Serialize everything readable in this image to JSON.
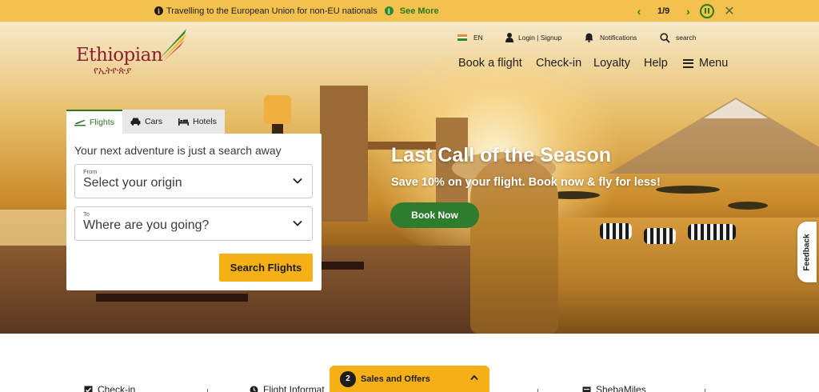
{
  "announcement": {
    "message": "Travelling to the European Union for non-EU nationals",
    "link_label": "See More",
    "pager": "1/9"
  },
  "logo": {
    "wordmark": "Ethiopian",
    "amharic": "የኢትዮጵያ"
  },
  "utility": {
    "language": "EN",
    "login": "Login | Signup",
    "notifications": "Notifications",
    "search": "search"
  },
  "nav": {
    "book": "Book a flight",
    "checkin": "Check-in",
    "loyalty": "Loyalty",
    "help": "Help",
    "menu": "Menu"
  },
  "booking": {
    "tabs": [
      "Flights",
      "Cars",
      "Hotels"
    ],
    "headline": "Your next adventure is just a search away",
    "from_label": "From",
    "from_value": "Select your origin",
    "to_label": "To",
    "to_value": "Where are you going?",
    "search_label": "Search Flights"
  },
  "promo": {
    "title": "Last Call of the Season",
    "subtitle": "Save 10% on your flight. Book now & fly for less!",
    "cta": "Book Now"
  },
  "feedback": "Feedback",
  "quick_links": [
    "Check-in",
    "Flight Informat",
    "ShebaMiles"
  ],
  "offers": {
    "count": "2",
    "label": "Sales and Offers"
  },
  "colors": {
    "brand_green": "#2b7a1e",
    "brand_yellow": "#f5b016",
    "topbar": "#f2c14e",
    "logo_red": "#8c2030"
  }
}
